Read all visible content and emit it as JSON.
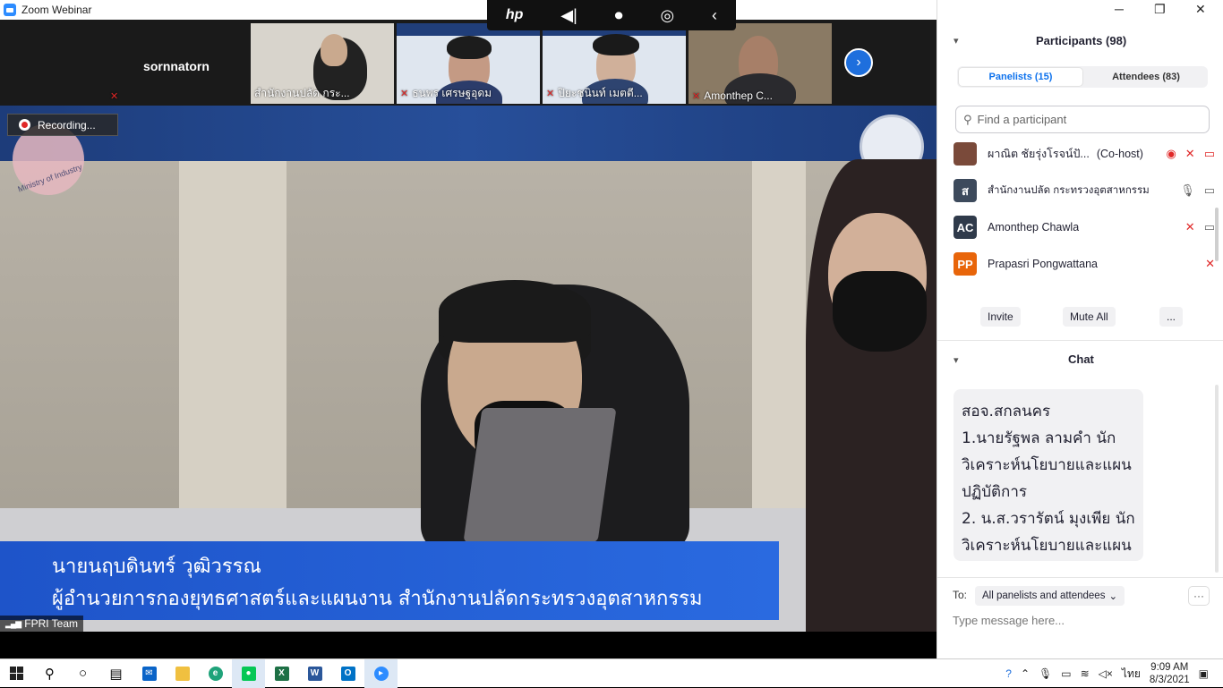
{
  "window": {
    "title": "Zoom Webinar"
  },
  "overlay": {
    "brand": "hp"
  },
  "thumbnails": [
    {
      "name": "sornnatorn",
      "muted": true
    },
    {
      "name": "สำนักงานปลัด กระ...",
      "muted": false
    },
    {
      "name": "ธนพร เศรษฐอุดม",
      "muted": true
    },
    {
      "name": "ปิยะชนินท์ เมตตี...",
      "muted": true
    },
    {
      "name": "Amonthep C...",
      "muted": true
    }
  ],
  "main": {
    "recording_label": "Recording...",
    "ministry_logo_text": "Ministry of Industry",
    "caption_line1": "นายนฤบดินทร์ วุฒิวรรณ",
    "caption_line2": "ผู้อำนวยการกองยุทธศาสตร์และแผนงาน สำนักงานปลัดกระทรวงอุตสาหกรรม",
    "speaker_label": "FPRI Team"
  },
  "participants": {
    "title": "Participants (98)",
    "tabs": [
      {
        "label": "Panelists (15)",
        "active": true
      },
      {
        "label": "Attendees (83)",
        "active": false
      }
    ],
    "search_placeholder": "Find a participant",
    "list": [
      {
        "initials": "",
        "name": "ผาณิต ชัยรุ่งโรจน์ปั...",
        "role": "(Co-host)",
        "avatar_color": "#7a4a3a"
      },
      {
        "initials": "ส",
        "name": "สำนักงานปลัด กระทรวงอุตสาหกรรม",
        "role": "",
        "avatar_color": "#3d4a5c"
      },
      {
        "initials": "AC",
        "name": "Amonthep Chawla",
        "role": "",
        "avatar_color": "#2f3a4a"
      },
      {
        "initials": "PP",
        "name": "Prapasri Pongwattana",
        "role": "",
        "avatar_color": "#e8650a"
      }
    ],
    "buttons": {
      "invite": "Invite",
      "mute_all": "Mute All",
      "more": "..."
    }
  },
  "chat": {
    "title": "Chat",
    "message_lines": [
      "สอจ.สกลนคร",
      "1.นายรัฐพล ลามคำ นัก",
      "วิเคราะห์นโยบายและแผน",
      "ปฏิบัติการ",
      "2. น.ส.วรารัตน์ มุงเพีย นัก",
      "วิเคราะห์นโยบายและแผน"
    ],
    "to_label": "To:",
    "to_value": "All panelists and attendees",
    "input_placeholder": "Type message here..."
  },
  "taskbar": {
    "time": "9:09 AM",
    "date": "8/3/2021",
    "language": "ไทย"
  },
  "colors": {
    "zoom_blue": "#0e72ed",
    "muted_red": "#e02828",
    "caption_blue": "#1e54c9"
  }
}
